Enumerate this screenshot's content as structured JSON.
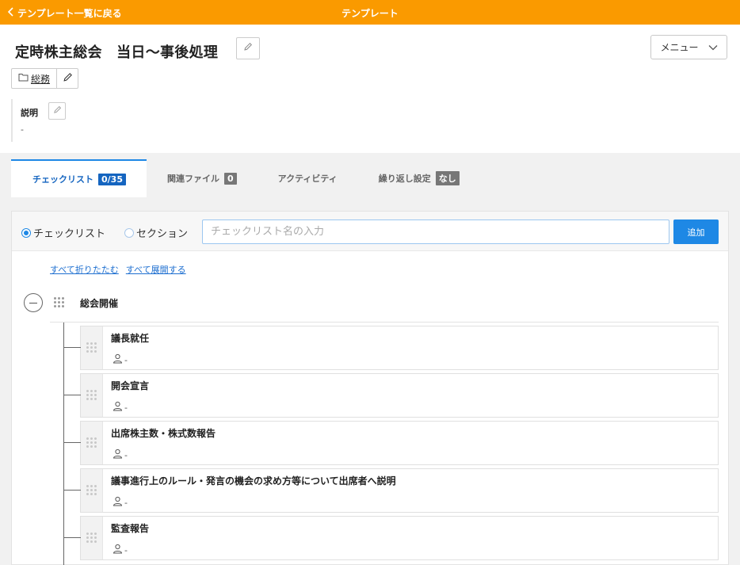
{
  "topbar": {
    "back_label": "テンプレート一覧に戻る",
    "title": "テンプレート"
  },
  "template": {
    "title": "定時株主総会　当日〜事後処理",
    "menu_label": "メニュー",
    "folder": "総務",
    "description_label": "説明",
    "description_value": "-"
  },
  "tabs": [
    {
      "label": "チェックリスト",
      "badge": "0/35",
      "active": true
    },
    {
      "label": "関連ファイル",
      "badge": "0",
      "active": false
    },
    {
      "label": "アクティビティ",
      "badge": "",
      "active": false
    },
    {
      "label": "繰り返し設定",
      "badge": "なし",
      "active": false
    }
  ],
  "add_form": {
    "radio_checklist": "チェックリスト",
    "radio_section": "セクション",
    "selected": "チェックリスト",
    "input_placeholder": "チェックリスト名の入力",
    "input_value": "",
    "add_button": "追加"
  },
  "links": {
    "collapse_all": "すべて折りたたむ",
    "expand_all": "すべて展開する"
  },
  "section": {
    "title": "総会開催",
    "items": [
      {
        "name": "議長就任",
        "assignee": "-"
      },
      {
        "name": "開会宣言",
        "assignee": "-"
      },
      {
        "name": "出席株主数・株式数報告",
        "assignee": "-"
      },
      {
        "name": "議事進行上のルール・発言の機会の求め方等について出席者へ説明",
        "assignee": "-"
      },
      {
        "name": "監査報告",
        "assignee": "-"
      }
    ]
  },
  "colors": {
    "topbar": "#fa9a00",
    "accent": "#1e88e5",
    "badge_active": "#1565c0",
    "badge_inactive": "#777777"
  }
}
